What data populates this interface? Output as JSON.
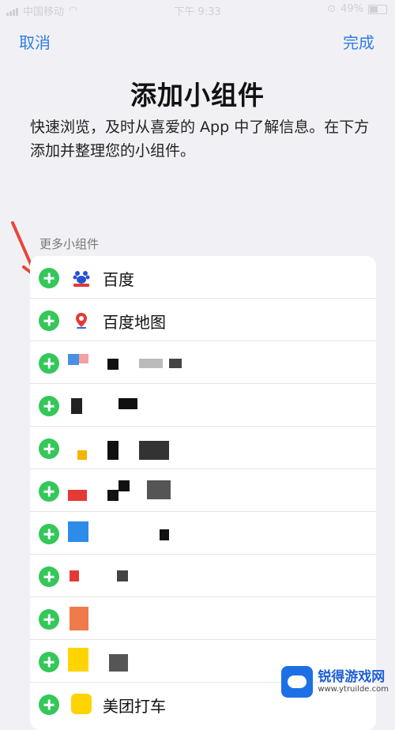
{
  "status_bar": {
    "carrier": "中国移动",
    "time": "下午 9:33",
    "battery": "49%"
  },
  "nav": {
    "cancel_label": "取消",
    "done_label": "完成"
  },
  "header": {
    "title": "添加小组件",
    "subtitle": "快速浏览，及时从喜爱的 App 中了解信息。在下方添加并整理您的小组件。"
  },
  "section": {
    "label": "更多小组件"
  },
  "widgets": [
    {
      "name": "百度",
      "icon": "baidu-icon"
    },
    {
      "name": "百度地图",
      "icon": "baidu-map-icon"
    },
    {
      "name": "",
      "icon": "redacted-icon"
    },
    {
      "name": "",
      "icon": "redacted-icon"
    },
    {
      "name": "",
      "icon": "redacted-icon"
    },
    {
      "name": "",
      "icon": "redacted-icon"
    },
    {
      "name": "",
      "icon": "redacted-icon"
    },
    {
      "name": "",
      "icon": "redacted-icon"
    },
    {
      "name": "",
      "icon": "redacted-icon"
    },
    {
      "name": "",
      "icon": "redacted-icon"
    },
    {
      "name": "美团打车",
      "icon": "meituan-icon"
    }
  ],
  "watermark": {
    "name": "锐得游戏网",
    "url": "www.ytruilde.com"
  },
  "colors": {
    "accent": "#2f7de1",
    "add_green": "#34c759",
    "annotation_red": "#e8463a"
  }
}
